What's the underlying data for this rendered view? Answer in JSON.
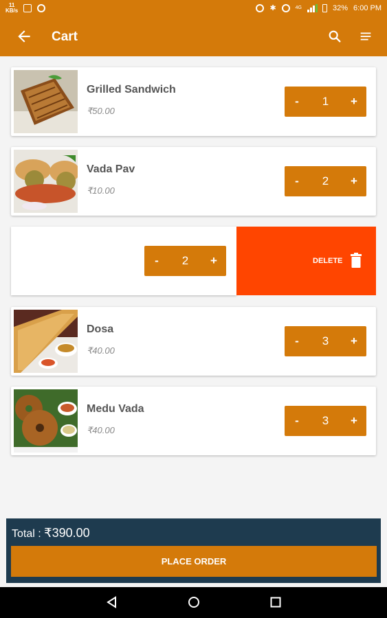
{
  "status_bar": {
    "net_speed_value": "11",
    "net_speed_unit": "KB/s",
    "network_type": "4G",
    "battery": "32%",
    "time": "6:00 PM"
  },
  "app_bar": {
    "title": "Cart",
    "icons": [
      "back-arrow-icon",
      "search-icon",
      "menu-icon"
    ]
  },
  "cart": {
    "items": [
      {
        "name": "Grilled Sandwich",
        "price": "₹50.00",
        "quantity": "1"
      },
      {
        "name": "Vada Pav",
        "price": "₹10.00",
        "quantity": "2"
      },
      {
        "name": "",
        "price": "",
        "quantity": "2"
      },
      {
        "name": "Dosa",
        "price": "₹40.00",
        "quantity": "3"
      },
      {
        "name": "Medu Vada",
        "price": "₹40.00",
        "quantity": "3"
      }
    ],
    "minus_label": "-",
    "plus_label": "+",
    "delete_label": "DELETE"
  },
  "footer": {
    "total_label": "Total : ",
    "total_value": "₹390.00",
    "place_order_label": "PLACE ORDER"
  },
  "colors": {
    "primary": "#d47a0a",
    "delete": "#ff4500",
    "footer": "#1e3b4f"
  }
}
